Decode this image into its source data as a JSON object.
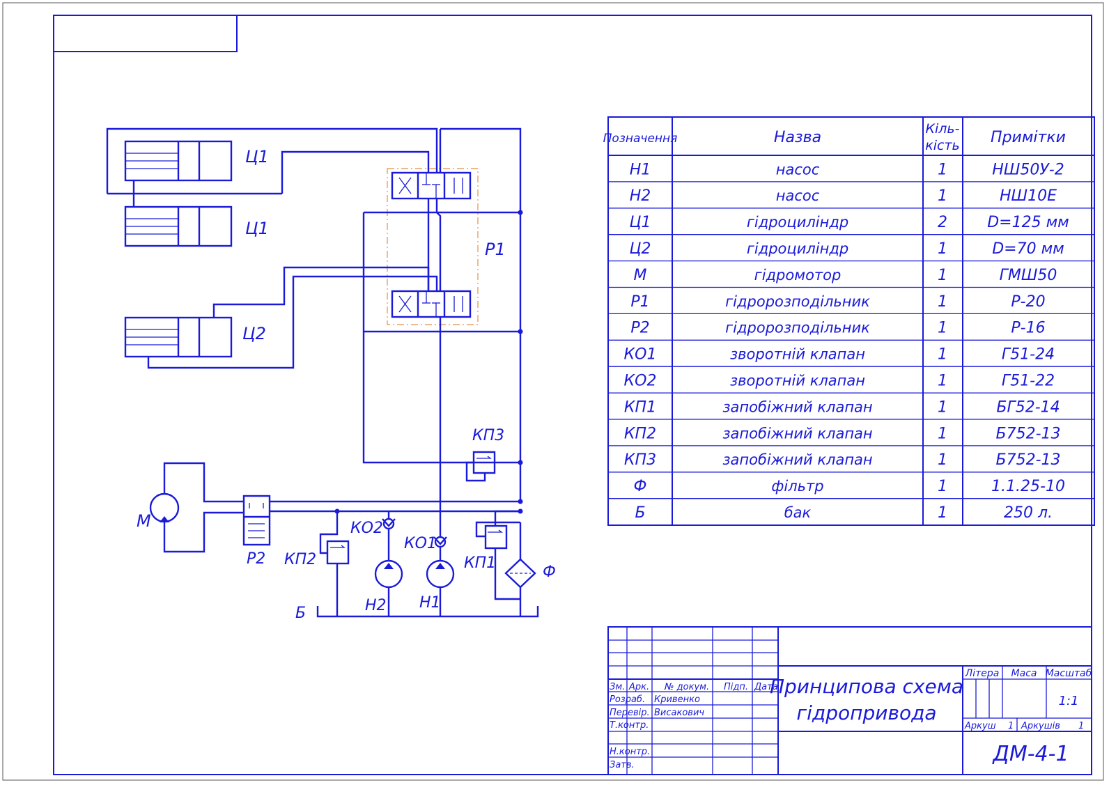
{
  "spec_table": {
    "headers": {
      "designation": "Позначення",
      "name": "Назва",
      "qty_line1": "Кіль-",
      "qty_line2": "кість",
      "notes": "Примітки"
    },
    "rows": [
      {
        "designation": "Н1",
        "name": "насос",
        "qty": "1",
        "notes": "НШ50У-2"
      },
      {
        "designation": "Н2",
        "name": "насос",
        "qty": "1",
        "notes": "НШ10Е"
      },
      {
        "designation": "Ц1",
        "name": "гідроцилiндр",
        "qty": "2",
        "notes": "D=125 мм"
      },
      {
        "designation": "Ц2",
        "name": "гідроцилiндр",
        "qty": "1",
        "notes": "D=70 мм"
      },
      {
        "designation": "М",
        "name": "гідромотор",
        "qty": "1",
        "notes": "ГМШ50"
      },
      {
        "designation": "Р1",
        "name": "гідророзподільник",
        "qty": "1",
        "notes": "Р-20"
      },
      {
        "designation": "Р2",
        "name": "гідророзподільник",
        "qty": "1",
        "notes": "Р-16"
      },
      {
        "designation": "КО1",
        "name": "зворотній клапан",
        "qty": "1",
        "notes": "Г51-24"
      },
      {
        "designation": "КО2",
        "name": "зворотній клапан",
        "qty": "1",
        "notes": "Г51-22"
      },
      {
        "designation": "КП1",
        "name": "запобіжний клапан",
        "qty": "1",
        "notes": "БГ52-14"
      },
      {
        "designation": "КП2",
        "name": "запобіжний клапан",
        "qty": "1",
        "notes": "Б752-13"
      },
      {
        "designation": "КП3",
        "name": "запобіжний клапан",
        "qty": "1",
        "notes": "Б752-13"
      },
      {
        "designation": "Ф",
        "name": "фільтр",
        "qty": "1",
        "notes": "1.1.25-10"
      },
      {
        "designation": "Б",
        "name": "бак",
        "qty": "1",
        "notes": "250 л."
      }
    ]
  },
  "title_block": {
    "col_change": "Зм.",
    "col_sheet": "Арк.",
    "col_doc": "№ докум.",
    "col_sign": "Підп.",
    "col_date": "Дата",
    "developed_label": "Розраб.",
    "developed_name": "Кривенко",
    "checked_label": "Перевір.",
    "checked_name": "Висакович",
    "tcontrol_label": "Т.контр.",
    "ncontrol_label": "Н.контр.",
    "approved_label": "Затв.",
    "title_line1": "Принципова схема",
    "title_line2": "гідропривода",
    "litera_label": "Літера",
    "mass_label": "Маса",
    "scale_label": "Масштаб",
    "scale_value": "1:1",
    "sheet_label": "Аркуш",
    "sheet_value": "1",
    "sheets_label": "Аркушів",
    "sheets_value": "1",
    "doc_code": "ДМ-4-1"
  },
  "schematic_labels": {
    "c1_top": "Ц1",
    "c1_bottom": "Ц1",
    "c2": "Ц2",
    "p1": "Р1",
    "p2": "Р2",
    "kp3": "КП3",
    "motor": "М",
    "ko2": "КО2",
    "ko1": "КО1",
    "kp2": "КП2",
    "kp1": "КП1",
    "filter": "Ф",
    "n2": "Н2",
    "n1": "Н1",
    "tank": "Б"
  }
}
